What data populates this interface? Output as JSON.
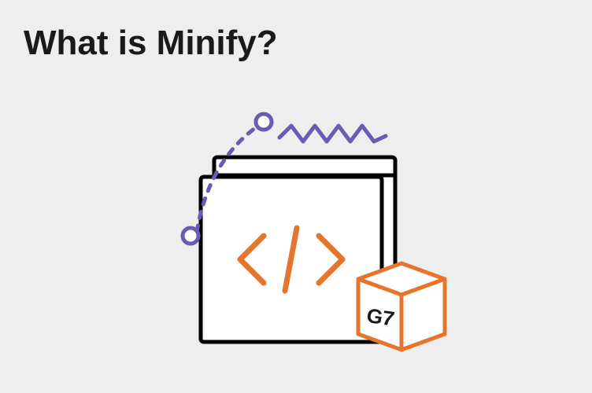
{
  "heading": "What is Minify?",
  "icons": {
    "box_label": "G7"
  },
  "colors": {
    "text": "#1a1a1a",
    "orange": "#e8742c",
    "purple": "#6b5bb5",
    "black": "#000000",
    "white": "#ffffff",
    "background": "#eeeeee"
  }
}
